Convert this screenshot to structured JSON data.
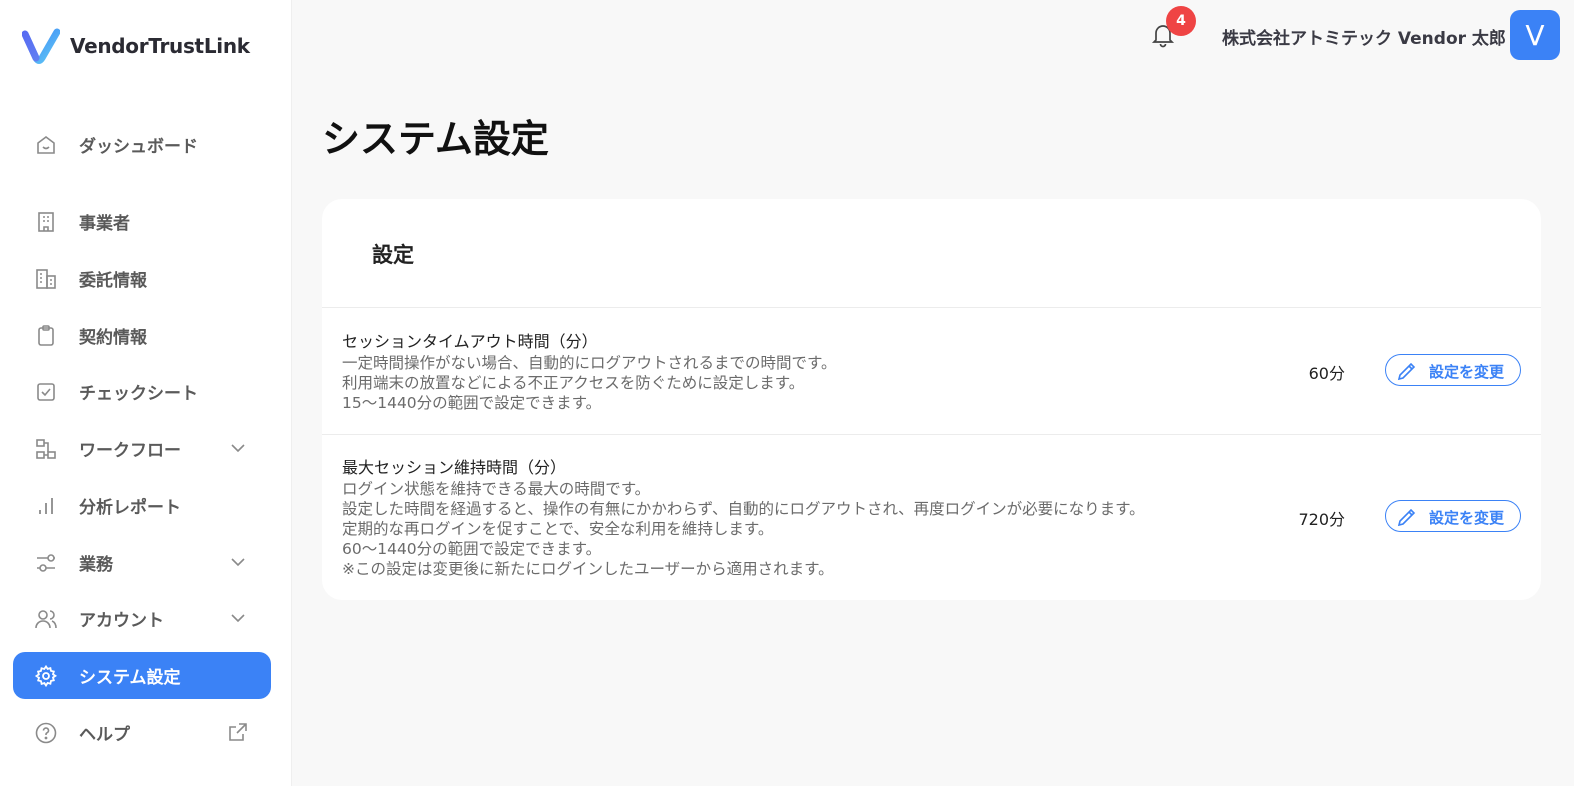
{
  "app": {
    "logo_text": "VendorTrustLink",
    "accent_color": "#3b82f6",
    "badge_color": "#ef4444"
  },
  "sidebar": {
    "items": [
      {
        "label": "ダッシュボード",
        "icon": "home-icon"
      },
      {
        "label": "事業者",
        "icon": "building-icon"
      },
      {
        "label": "委託情報",
        "icon": "office-building-icon"
      },
      {
        "label": "契約情報",
        "icon": "clipboard-icon"
      },
      {
        "label": "チェックシート",
        "icon": "checkbox-icon"
      },
      {
        "label": "ワークフロー",
        "icon": "workflow-icon",
        "expandable": true
      },
      {
        "label": "分析レポート",
        "icon": "bar-chart-icon"
      },
      {
        "label": "業務",
        "icon": "sliders-icon",
        "expandable": true
      },
      {
        "label": "アカウント",
        "icon": "users-icon",
        "expandable": true
      },
      {
        "label": "システム設定",
        "icon": "gear-icon",
        "active": true
      },
      {
        "label": "ヘルプ",
        "icon": "help-icon",
        "external": true
      }
    ]
  },
  "header": {
    "notification_count": "4",
    "user_name": "株式会社アトミテック Vendor 太郎",
    "avatar_initial": "V"
  },
  "main": {
    "page_title": "システム設定",
    "card_title": "設定",
    "settings": [
      {
        "name": "セッションタイムアウト時間（分）",
        "description": [
          "一定時間操作がない場合、自動的にログアウトされるまでの時間です。",
          "利用端末の放置などによる不正アクセスを防ぐために設定します。",
          "15〜1440分の範囲で設定できます。"
        ],
        "value": "60分",
        "button_label": "設定を変更"
      },
      {
        "name": "最大セッション維持時間（分）",
        "description": [
          "ログイン状態を維持できる最大の時間です。",
          "設定した時間を経過すると、操作の有無にかかわらず、自動的にログアウトされ、再度ログインが必要になります。",
          "定期的な再ログインを促すことで、安全な利用を維持します。",
          "60〜1440分の範囲で設定できます。",
          "※この設定は変更後に新たにログインしたユーザーから適用されます。"
        ],
        "value": "720分",
        "button_label": "設定を変更"
      }
    ]
  }
}
